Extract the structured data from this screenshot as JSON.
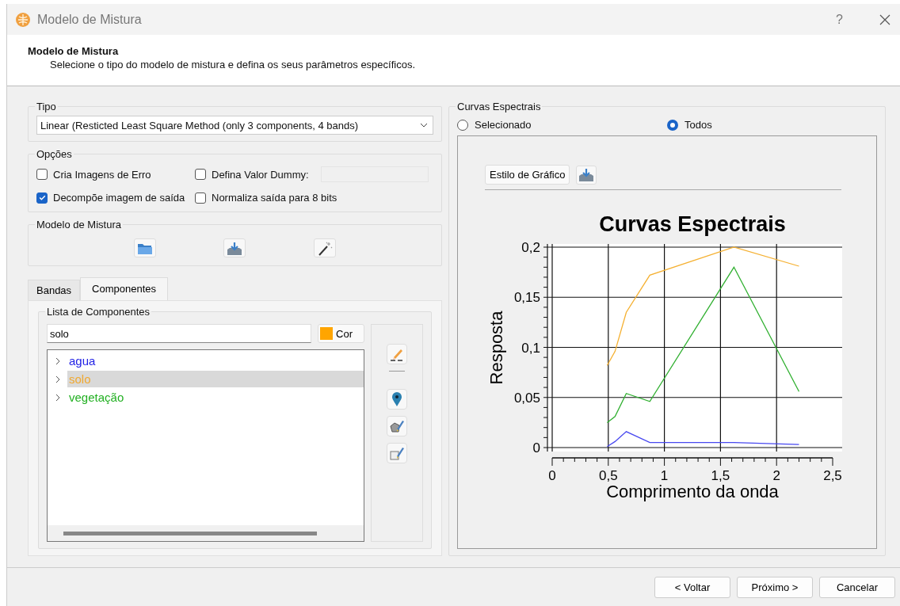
{
  "window": {
    "title": "Modelo de Mistura",
    "help": "?"
  },
  "header": {
    "title": "Modelo de Mistura",
    "subtitle": "Selecione o tipo do modelo de mistura e defina os seus parâmetros específicos."
  },
  "tipo": {
    "label": "Tipo",
    "value": "Linear (Resticted Least Square Method (only 3 components, 4 bands)"
  },
  "opcoes": {
    "label": "Opções",
    "checkboxes": [
      {
        "label": "Cria Imagens de Erro",
        "checked": false
      },
      {
        "label": "Defina Valor Dummy:",
        "checked": false
      },
      {
        "label": "Decompõe imagem de saída",
        "checked": true
      },
      {
        "label": "Normaliza saída para 8 bits",
        "checked": false
      }
    ],
    "dummy_field": {
      "disabled": true
    }
  },
  "modelo": {
    "label": "Modelo de Mistura"
  },
  "tabs": [
    {
      "label": "Bandas",
      "selected": false
    },
    {
      "label": "Componentes",
      "selected": true
    }
  ],
  "components": {
    "label": "Lista de Componentes",
    "name_field": "solo",
    "color_button": {
      "label": "Cor",
      "color": "#ffa500"
    },
    "items": [
      {
        "label": "agua",
        "color": "#2323e6",
        "selected": false,
        "expanded": false
      },
      {
        "label": "solo",
        "color": "#f0a830",
        "selected": true,
        "expanded": false
      },
      {
        "label": "vegetação",
        "color": "#22b022",
        "selected": false,
        "expanded": false
      }
    ]
  },
  "curvas": {
    "label": "Curvas Espectrais",
    "radios": [
      {
        "label": "Selecionado",
        "selected": false
      },
      {
        "label": "Todos",
        "selected": true
      }
    ],
    "style_button": "Estilo de Gráfico",
    "chart_data": {
      "type": "line",
      "title": "Curvas Espectrais",
      "xlabel": "Comprimento da onda",
      "ylabel": "Resposta",
      "x": [
        0.49,
        0.56,
        0.66,
        0.87,
        1.62,
        2.2
      ],
      "series": [
        {
          "color": "#f5b030",
          "values": [
            0.082,
            0.096,
            0.135,
            0.172,
            0.2,
            0.181
          ]
        },
        {
          "color": "#30b030",
          "values": [
            0.025,
            0.031,
            0.054,
            0.046,
            0.18,
            0.056
          ]
        },
        {
          "color": "#4848f0",
          "values": [
            0.001,
            0.006,
            0.016,
            0.005,
            0.005,
            0.003
          ]
        }
      ],
      "grid": true,
      "xlim": [
        0,
        2.5
      ],
      "ylim": [
        0,
        0.2
      ],
      "xticks": [
        {
          "value": 0,
          "label": "0"
        },
        {
          "value": 0.5,
          "label": "0,5"
        },
        {
          "value": 1,
          "label": "1"
        },
        {
          "value": 1.5,
          "label": "1,5"
        },
        {
          "value": 2,
          "label": "2"
        },
        {
          "value": 2.5,
          "label": "2,5"
        }
      ],
      "yticks": [
        {
          "value": 0,
          "label": "0"
        },
        {
          "value": 0.05,
          "label": "0,05"
        },
        {
          "value": 0.1,
          "label": "0,1"
        },
        {
          "value": 0.15,
          "label": "0,15"
        },
        {
          "value": 0.2,
          "label": "0,2"
        }
      ]
    }
  },
  "buttons": [
    "< Voltar",
    "Próximo >",
    "Cancelar"
  ]
}
